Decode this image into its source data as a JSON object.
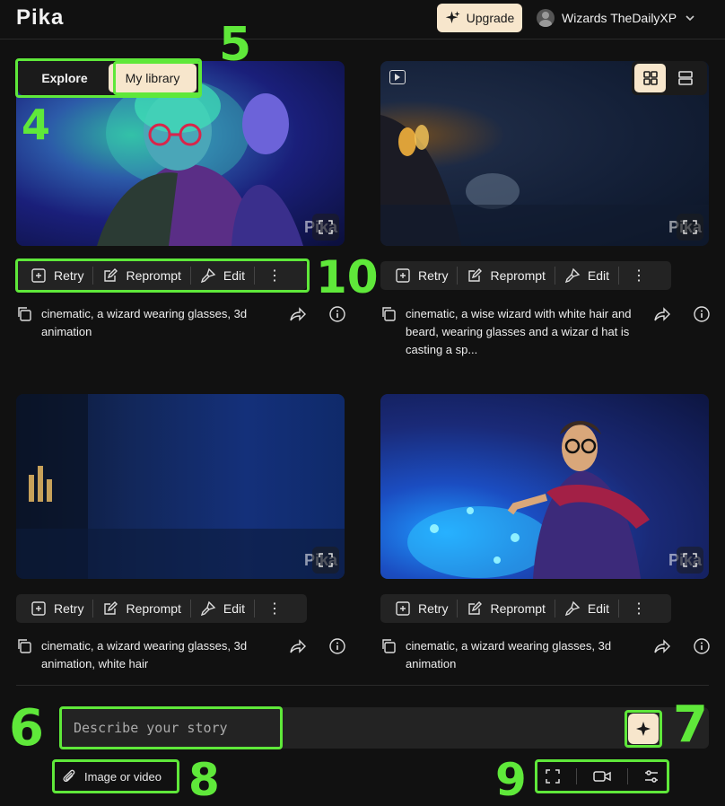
{
  "header": {
    "logo": "Pika",
    "upgrade_label": "Upgrade",
    "user_name": "Wizards TheDailyXP"
  },
  "nav": {
    "explore_label": "Explore",
    "library_label": "My library",
    "active": "My library"
  },
  "view_mode": {
    "active": "grid"
  },
  "cards": [
    {
      "prompt": "cinematic, a wizard wearing glasses, 3d animation",
      "watermark": "Pika"
    },
    {
      "prompt": "cinematic, a wise wizard with white hair and beard, wearing glasses and a wizar d hat is casting a sp...",
      "watermark": "Pika"
    },
    {
      "prompt": "cinematic, a wizard wearing glasses, 3d animation, white hair",
      "watermark": "Pika"
    },
    {
      "prompt": "cinematic, a wizard wearing glasses, 3d animation",
      "watermark": "Pika"
    }
  ],
  "card_actions": {
    "retry": "Retry",
    "reprompt": "Reprompt",
    "edit": "Edit",
    "more": "⋮"
  },
  "prompt": {
    "placeholder": "Describe your story",
    "attach_label": "Image or video"
  },
  "annotations": {
    "toggle": "4",
    "library_tab": "5",
    "prompt_input": "6",
    "generate": "7",
    "attach": "8",
    "tools": "9",
    "actions": "10"
  },
  "colors": {
    "accent": "#f7e6cc",
    "background": "#111111",
    "annotation": "#5fe83a"
  }
}
